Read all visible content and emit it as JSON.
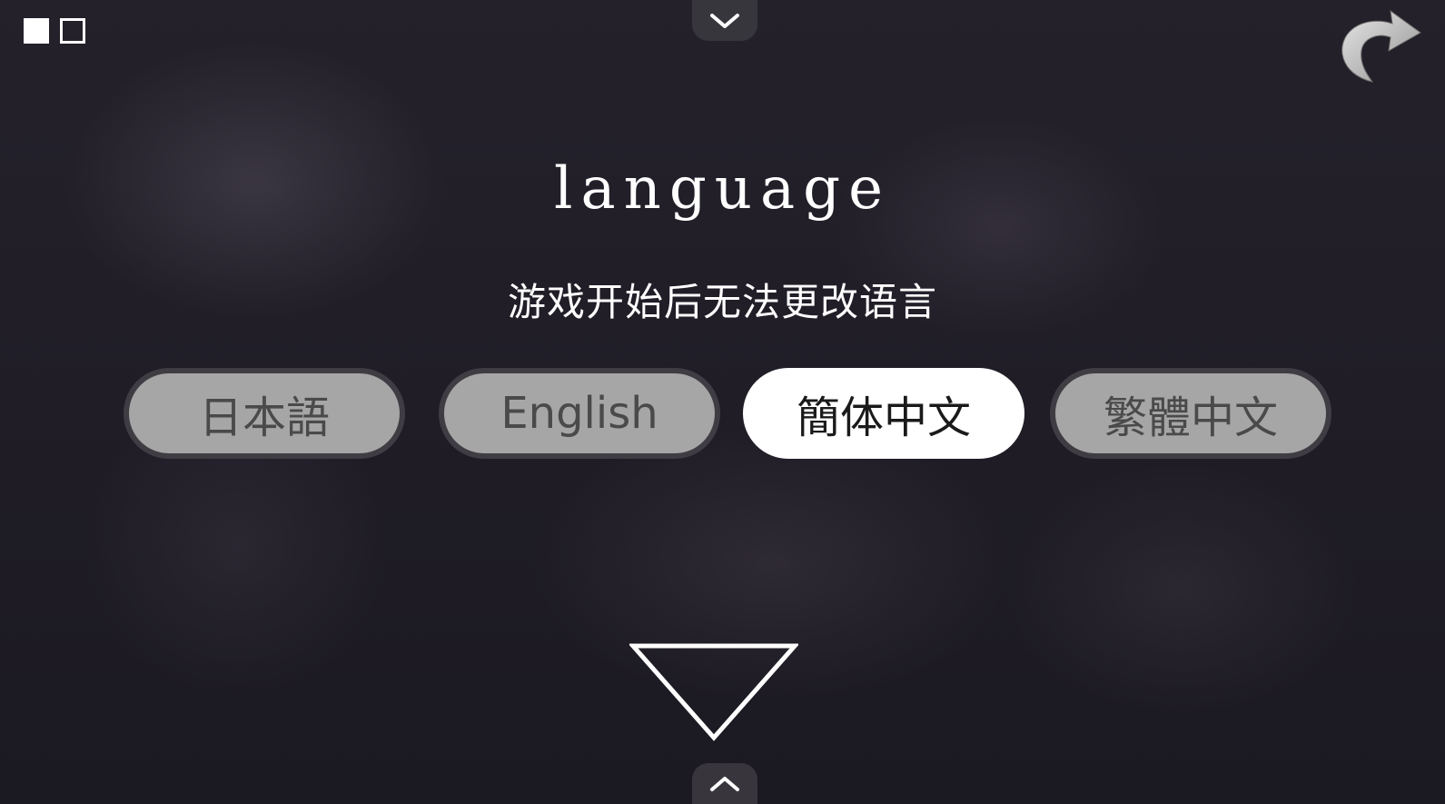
{
  "header": {
    "view_toggle_icons": [
      "filled-square-icon",
      "outline-square-icon"
    ],
    "top_tab_icon": "chevron-down-icon",
    "back_icon": "curved-arrow-icon"
  },
  "main": {
    "title": "language",
    "notice": "游戏开始后无法更改语言",
    "languages": [
      {
        "label": "日本語",
        "selected": false
      },
      {
        "label": "English",
        "selected": false
      },
      {
        "label": "簡体中文",
        "selected": true
      },
      {
        "label": "繁體中文",
        "selected": false
      }
    ],
    "confirm_icon": "down-triangle-icon"
  },
  "footer": {
    "bottom_tab_icon": "chevron-up-icon"
  },
  "colors": {
    "selected_button": "#ffffff",
    "unselected_button": "#a6a6a6",
    "text": "#ffffff"
  }
}
